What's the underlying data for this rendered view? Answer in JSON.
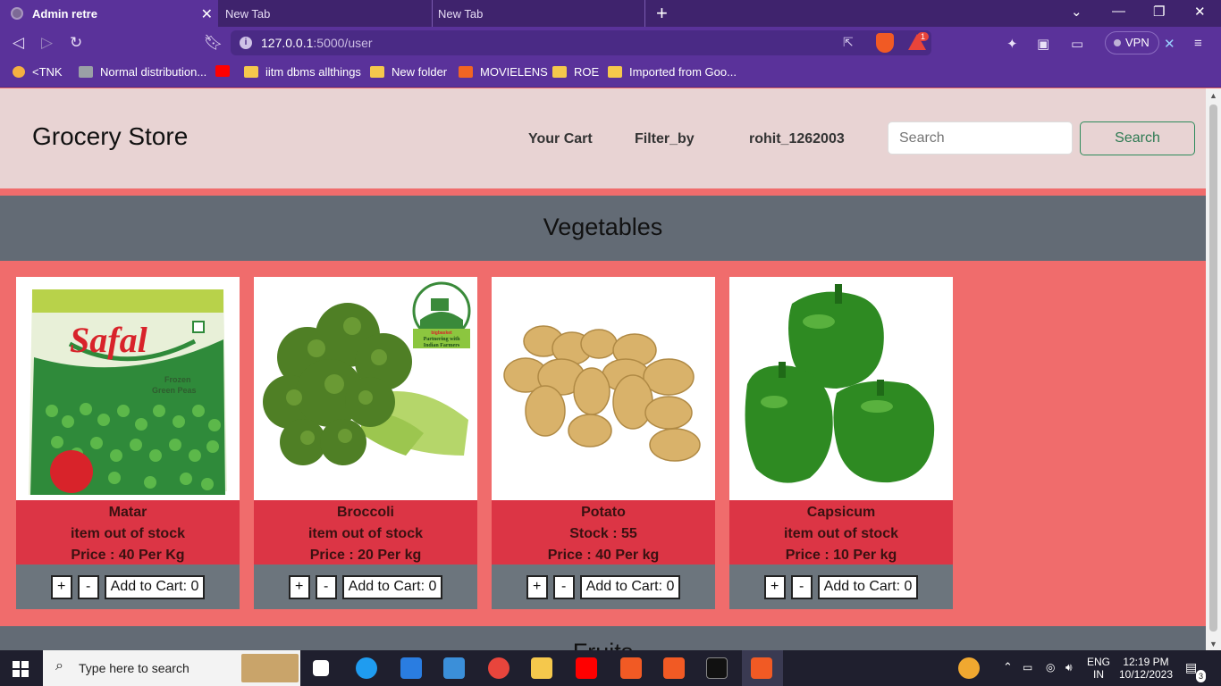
{
  "browser": {
    "tabs": [
      {
        "title": "Admin retre",
        "active": true
      },
      {
        "title": "New Tab",
        "active": false
      },
      {
        "title": "New Tab",
        "active": false
      }
    ],
    "url_host": "127.0.0.1",
    "url_path": ":5000/user",
    "rewards_badge": "1",
    "vpn_label": "VPN",
    "bookmarks": [
      "<TNK",
      "Normal distribution...",
      "iitm dbms allthings",
      "New folder",
      "MOVIELENS",
      "ROE",
      "Imported from Goo..."
    ]
  },
  "navbar": {
    "brand": "Grocery Store",
    "links": [
      "Your Cart",
      "Filter_by",
      "rohit_1262003"
    ],
    "search_placeholder": "Search",
    "search_button": "Search"
  },
  "sections": [
    {
      "title": "Vegetables",
      "products": [
        {
          "name": "Matar",
          "stock": "item out of stock",
          "price": "Price : 40 Per Kg",
          "image": "frozen-peas-packet",
          "cart_label": "Add to Cart: 0"
        },
        {
          "name": "Broccoli",
          "stock": "item out of stock",
          "price": "Price : 20 Per kg",
          "image": "broccoli",
          "cart_label": "Add to Cart: 0"
        },
        {
          "name": "Potato",
          "stock": "Stock : 55",
          "price": "Price : 40 Per kg",
          "image": "potatoes",
          "cart_label": "Add to Cart: 0"
        },
        {
          "name": "Capsicum",
          "stock": "item out of stock",
          "price": "Price : 10 Per kg",
          "image": "green-capsicum",
          "cart_label": "Add to Cart: 0"
        }
      ]
    },
    {
      "title": "Fruits"
    }
  ],
  "image_text": {
    "safal_brand": "Safal",
    "safal_product": [
      "Frozen",
      "Green Peas"
    ],
    "bigbasket_badge": [
      "bigbasket",
      "Partnering with",
      "Indian Farmers"
    ]
  },
  "qty_plus": "+",
  "qty_minus": "-",
  "taskbar": {
    "search_placeholder": "Type here to search",
    "lang": "ENG",
    "region": "IN",
    "time": "12:19 PM",
    "date": "10/12/2023",
    "notifications": "3"
  },
  "colors": {
    "browser_purple": "#5a329a",
    "navbar_bg": "#e8d3d3",
    "page_bg": "#f06c6c",
    "section_header": "#636b75",
    "card_info": "#dc3545",
    "card_actions": "#6c757d"
  }
}
